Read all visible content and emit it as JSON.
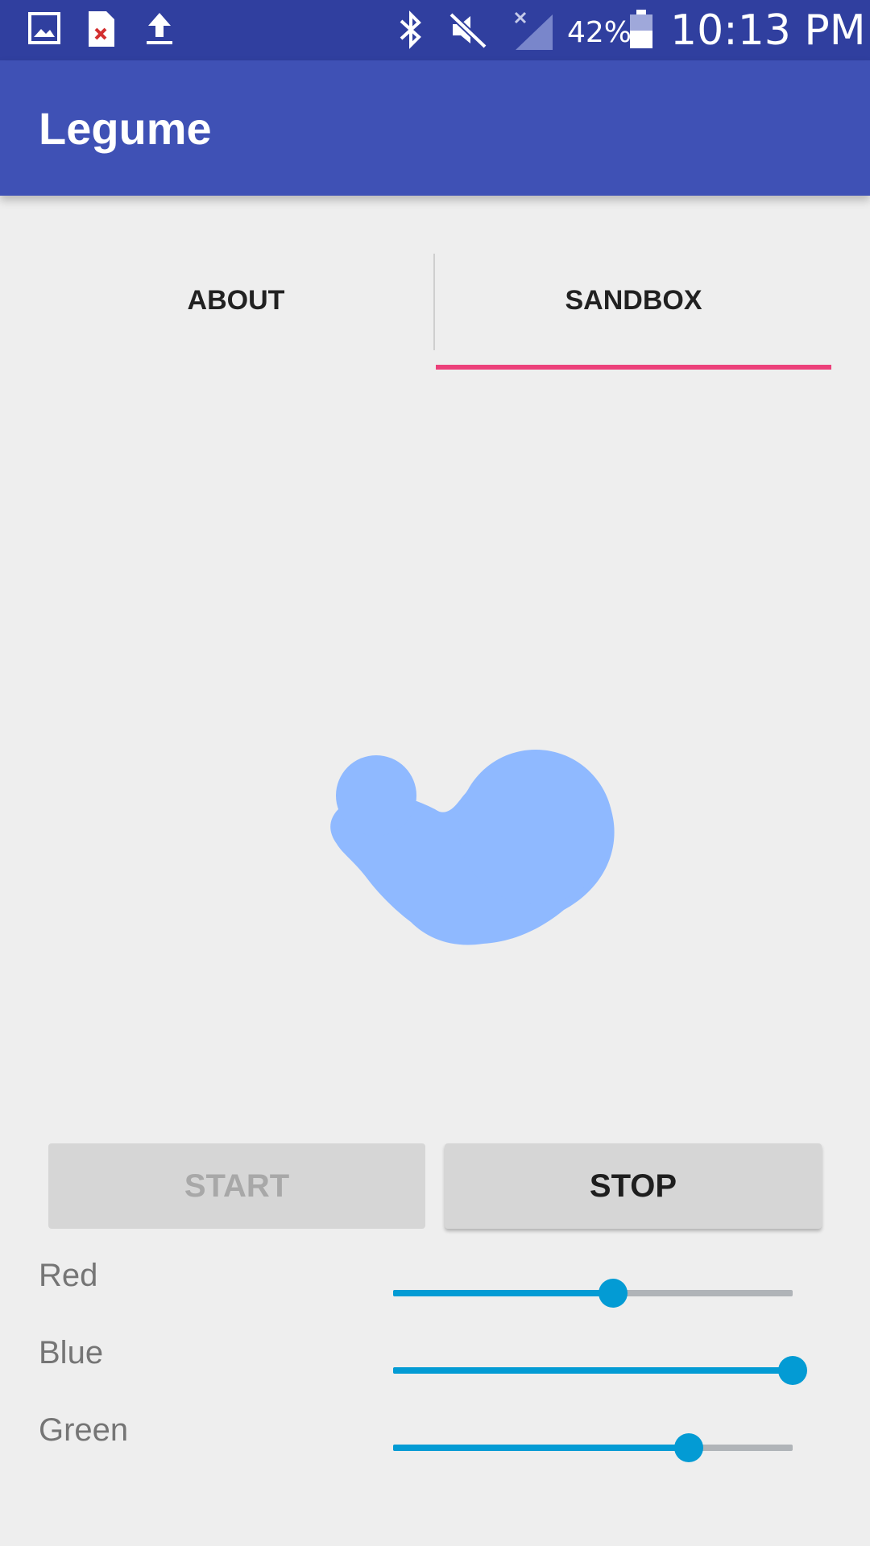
{
  "status_bar": {
    "icons": [
      "gallery-icon",
      "file-error-icon",
      "upload-icon",
      "bluetooth-icon",
      "mute-icon",
      "no-signal-icon",
      "battery-icon"
    ],
    "battery": "42%",
    "time": "10:13 PM"
  },
  "app_bar": {
    "title": "Legume"
  },
  "tabs": [
    {
      "label": "ABOUT",
      "selected": false
    },
    {
      "label": "SANDBOX",
      "selected": true
    }
  ],
  "colors": {
    "primary_dark": "#303f9f",
    "primary": "#3f51b5",
    "tab_indicator": "#ec407a",
    "slider_accent": "#039bd4",
    "blob": "#8fb9ff"
  },
  "canvas": {
    "shape": "blob"
  },
  "buttons": {
    "start": {
      "label": "START",
      "enabled": false
    },
    "stop": {
      "label": "STOP",
      "enabled": true
    }
  },
  "sliders": [
    {
      "label": "Red",
      "value": 0.55
    },
    {
      "label": "Blue",
      "value": 1.0
    },
    {
      "label": "Green",
      "value": 0.74
    }
  ]
}
